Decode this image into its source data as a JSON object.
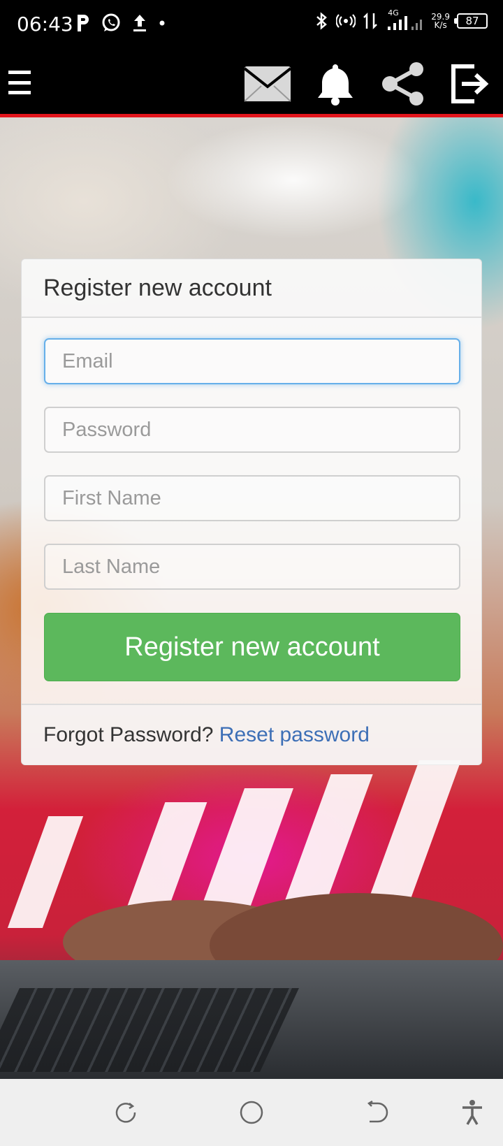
{
  "status_bar": {
    "time": "06:43",
    "net_speed_value": "29.9",
    "net_speed_unit": "K/s",
    "network_type": "4G",
    "battery": "87"
  },
  "header": {
    "icons": [
      "menu-icon",
      "mail-icon",
      "bell-icon",
      "share-icon",
      "logout-icon"
    ],
    "accent_color": "#e3151c"
  },
  "form": {
    "title": "Register new account",
    "email_placeholder": "Email",
    "password_placeholder": "Password",
    "first_name_placeholder": "First Name",
    "last_name_placeholder": "Last Name",
    "submit_label": "Register new account",
    "submit_color": "#5cb85c",
    "footer_text": "Forgot Password?",
    "reset_link_label": "Reset password",
    "link_color": "#3d6fb6"
  },
  "nav_bar": {
    "icons": [
      "recent-apps-icon",
      "home-icon",
      "back-icon",
      "accessibility-icon"
    ]
  }
}
